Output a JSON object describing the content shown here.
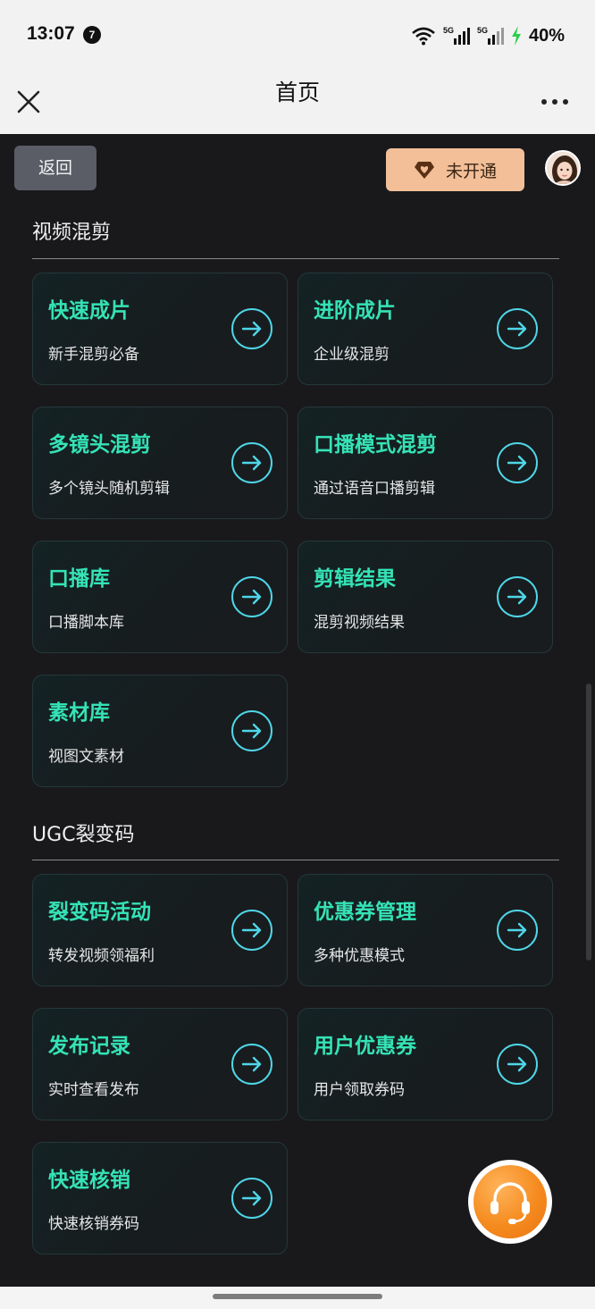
{
  "status_bar": {
    "time": "13:07",
    "notification_badge": "7",
    "signal_1": "5G",
    "signal_2": "5G",
    "battery": "40%",
    "charging_color": "#2bd04b"
  },
  "nav": {
    "title": "首页",
    "close_icon": "close-icon",
    "more_icon": "more-icon"
  },
  "toolbar": {
    "back_label": "返回",
    "vip_label": "未开通",
    "vip_icon": "diamond-heart-icon"
  },
  "sections": [
    {
      "title": "视频混剪",
      "cards": [
        {
          "title": "快速成片",
          "subtitle": "新手混剪必备"
        },
        {
          "title": "进阶成片",
          "subtitle": "企业级混剪"
        },
        {
          "title": "多镜头混剪",
          "subtitle": "多个镜头随机剪辑"
        },
        {
          "title": "口播模式混剪",
          "subtitle": "通过语音口播剪辑"
        },
        {
          "title": "口播库",
          "subtitle": "口播脚本库"
        },
        {
          "title": "剪辑结果",
          "subtitle": "混剪视频结果"
        },
        {
          "title": "素材库",
          "subtitle": "视图文素材"
        }
      ]
    },
    {
      "title": "UGC裂变码",
      "cards": [
        {
          "title": "裂变码活动",
          "subtitle": "转发视频领福利"
        },
        {
          "title": "优惠券管理",
          "subtitle": "多种优惠模式"
        },
        {
          "title": "发布记录",
          "subtitle": "实时查看发布"
        },
        {
          "title": "用户优惠券",
          "subtitle": "用户领取券码"
        },
        {
          "title": "快速核销",
          "subtitle": "快速核销券码"
        }
      ]
    }
  ],
  "colors": {
    "accent": "#35e3b6",
    "arrow": "#4fd6e8",
    "vip_bg": "#f2bf98",
    "support": "#f58b1f"
  },
  "support_icon": "headset-icon"
}
